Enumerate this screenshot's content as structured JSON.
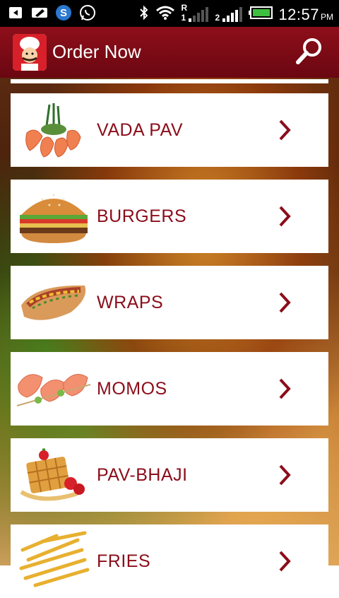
{
  "status_bar": {
    "time": "12:57",
    "ampm": "PM",
    "signal_label_r": "R",
    "signal_label_1": "1",
    "signal_label_2": "2"
  },
  "app_bar": {
    "title": "Order Now",
    "logo_icon": "chef-icon",
    "search_icon": "search-icon"
  },
  "menu": {
    "items": [
      {
        "label": "VADA PAV",
        "image": "shrimp-platter"
      },
      {
        "label": "BURGERS",
        "image": "burger"
      },
      {
        "label": "WRAPS",
        "image": "hotdog-wrap"
      },
      {
        "label": "MOMOS",
        "image": "shrimp-skewers"
      },
      {
        "label": "PAV-BHAJI",
        "image": "waffle-strawberries"
      },
      {
        "label": "FRIES",
        "image": "french-fries"
      }
    ]
  },
  "colors": {
    "accent": "#8b0d1a",
    "appbar": "#7a0a15"
  }
}
